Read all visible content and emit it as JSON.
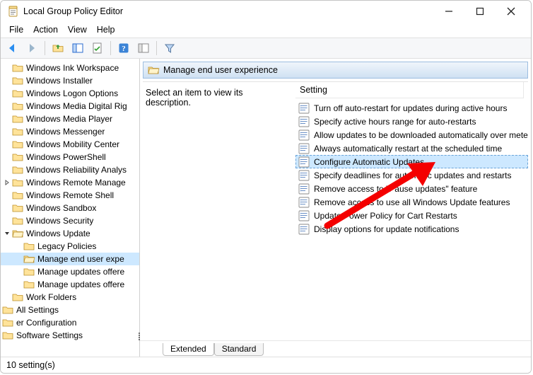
{
  "window": {
    "title": "Local Group Policy Editor"
  },
  "menu": {
    "file": "File",
    "action": "Action",
    "view": "View",
    "help": "Help"
  },
  "tree": [
    {
      "indent": 1,
      "twisty": "",
      "icon": "folder",
      "label": "Windows Ink Workspace"
    },
    {
      "indent": 1,
      "twisty": "",
      "icon": "folder",
      "label": "Windows Installer"
    },
    {
      "indent": 1,
      "twisty": "",
      "icon": "folder",
      "label": "Windows Logon Options"
    },
    {
      "indent": 1,
      "twisty": "",
      "icon": "folder",
      "label": "Windows Media Digital Rig"
    },
    {
      "indent": 1,
      "twisty": "",
      "icon": "folder",
      "label": "Windows Media Player"
    },
    {
      "indent": 1,
      "twisty": "",
      "icon": "folder",
      "label": "Windows Messenger"
    },
    {
      "indent": 1,
      "twisty": "",
      "icon": "folder",
      "label": "Windows Mobility Center"
    },
    {
      "indent": 1,
      "twisty": "",
      "icon": "folder",
      "label": "Windows PowerShell"
    },
    {
      "indent": 1,
      "twisty": "",
      "icon": "folder",
      "label": "Windows Reliability Analys"
    },
    {
      "indent": 1,
      "twisty": "›",
      "icon": "folder",
      "label": "Windows Remote Manage"
    },
    {
      "indent": 1,
      "twisty": "",
      "icon": "folder",
      "label": "Windows Remote Shell"
    },
    {
      "indent": 1,
      "twisty": "",
      "icon": "folder",
      "label": "Windows Sandbox"
    },
    {
      "indent": 1,
      "twisty": "",
      "icon": "folder",
      "label": "Windows Security"
    },
    {
      "indent": 1,
      "twisty": "⌄",
      "icon": "folder-open",
      "label": "Windows Update"
    },
    {
      "indent": 2,
      "twisty": "",
      "icon": "folder",
      "label": "Legacy Policies"
    },
    {
      "indent": 2,
      "twisty": "",
      "icon": "folder-open",
      "label": "Manage end user expe",
      "selected": true
    },
    {
      "indent": 2,
      "twisty": "",
      "icon": "folder",
      "label": "Manage updates offere"
    },
    {
      "indent": 2,
      "twisty": "",
      "icon": "folder",
      "label": "Manage updates offere"
    },
    {
      "indent": 1,
      "twisty": "",
      "icon": "folder",
      "label": "Work Folders"
    },
    {
      "indent": 0,
      "twisty": "",
      "icon": "folder",
      "label": "All Settings"
    },
    {
      "indent": 0,
      "twisty": "",
      "icon": "node",
      "label": "er Configuration",
      "noicon": true,
      "truncL": true
    },
    {
      "indent": 0,
      "twisty": "",
      "icon": "folder",
      "label": "Software Settings",
      "truncL": true
    }
  ],
  "detail": {
    "header": "Manage end user experience",
    "desc": "Select an item to view its description.",
    "column": "Setting",
    "items": [
      {
        "label": "Turn off auto-restart for updates during active hours"
      },
      {
        "label": "Specify active hours range for auto-restarts"
      },
      {
        "label": "Allow updates to be downloaded automatically over metere"
      },
      {
        "label": "Always automatically restart at the scheduled time"
      },
      {
        "label": "Configure Automatic Updates",
        "selected": true
      },
      {
        "label": "Specify deadlines for automatic updates and restarts"
      },
      {
        "label": "Remove access to \"Pause updates\" feature"
      },
      {
        "label": "Remove access to use all Windows Update features"
      },
      {
        "label": "Update Power Policy for Cart Restarts"
      },
      {
        "label": "Display options for update notifications"
      }
    ],
    "tabs": {
      "extended": "Extended",
      "standard": "Standard"
    }
  },
  "status": "10 setting(s)"
}
